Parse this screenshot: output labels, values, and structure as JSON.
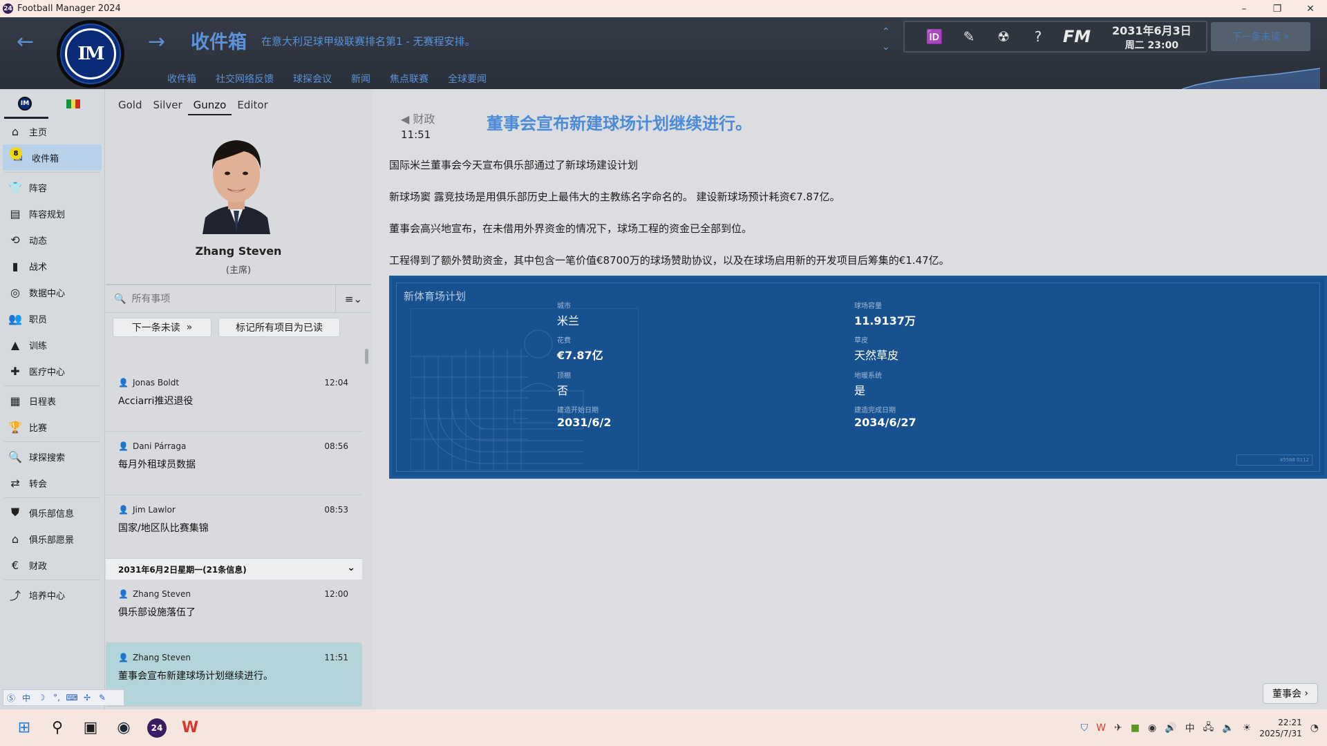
{
  "window": {
    "title": "Football Manager 2024",
    "icon_text": "24"
  },
  "header": {
    "title": "收件箱",
    "subtitle": "在意大利足球甲级联赛排名第1 - 无赛程安排。",
    "tabs": [
      "收件箱",
      "社交网络反馈",
      "球探会议",
      "新闻",
      "焦点联赛",
      "全球要闻"
    ],
    "date": "2031年6月3日",
    "day_time": "周二 23:00",
    "next_unread": "下一条未读",
    "fm_logo": "FM"
  },
  "sidebar": {
    "items": [
      {
        "icon": "home-icon",
        "glyph": "⌂",
        "label": "主页"
      },
      {
        "icon": "inbox-icon",
        "glyph": "✉",
        "label": "收件箱",
        "badge": "8"
      },
      {
        "icon": "squad-icon",
        "glyph": "👕",
        "label": "阵容"
      },
      {
        "icon": "squad-planner-icon",
        "glyph": "▤",
        "label": "阵容规划"
      },
      {
        "icon": "dynamics-icon",
        "glyph": "⟲",
        "label": "动态"
      },
      {
        "icon": "tactics-icon",
        "glyph": "▮",
        "label": "战术"
      },
      {
        "icon": "data-hub-icon",
        "glyph": "◎",
        "label": "数据中心"
      },
      {
        "icon": "staff-icon",
        "glyph": "👥",
        "label": "职员"
      },
      {
        "icon": "training-icon",
        "glyph": "▲",
        "label": "训练"
      },
      {
        "icon": "medical-icon",
        "glyph": "✚",
        "label": "医疗中心"
      },
      {
        "icon": "schedule-icon",
        "glyph": "▦",
        "label": "日程表"
      },
      {
        "icon": "competitions-icon",
        "glyph": "🏆",
        "label": "比赛"
      },
      {
        "icon": "scouting-icon",
        "glyph": "🔍",
        "label": "球探搜索"
      },
      {
        "icon": "transfers-icon",
        "glyph": "⇄",
        "label": "转会"
      },
      {
        "icon": "club-info-icon",
        "glyph": "⛊",
        "label": "俱乐部信息"
      },
      {
        "icon": "club-vision-icon",
        "glyph": "⌂",
        "label": "俱乐部愿景"
      },
      {
        "icon": "finances-icon",
        "glyph": "€",
        "label": "财政"
      },
      {
        "icon": "development-icon",
        "glyph": "⤴",
        "label": "培养中心"
      }
    ]
  },
  "middle": {
    "staff_tabs": [
      "Gold",
      "Silver",
      "Gunzo",
      "Editor"
    ],
    "person_name": "Zhang Steven",
    "person_role": "(主席)",
    "search_placeholder": "所有事项",
    "next_unread_btn": "下一条未读",
    "mark_read_btn": "标记所有项目为已读",
    "messages_top": [
      {
        "sender": "Jonas Boldt",
        "time": "12:04",
        "subject": "Acciarri推迟退役"
      },
      {
        "sender": "Dani Párraga",
        "time": "08:56",
        "subject": "每月外租球员数据"
      },
      {
        "sender": "Jim Lawlor",
        "time": "08:53",
        "subject": "国家/地区队比赛集锦"
      }
    ],
    "day_header": "2031年6月2日星期一(21条信息)",
    "messages_bottom": [
      {
        "sender": "Zhang Steven",
        "time": "12:00",
        "subject": "俱乐部设施落伍了"
      },
      {
        "sender": "Zhang Steven",
        "time": "11:51",
        "subject": "董事会宣布新建球场计划继续进行。"
      }
    ]
  },
  "news": {
    "category": "财政",
    "time": "11:51",
    "headline": "董事会宣布新建球场计划继续进行。",
    "paragraphs": [
      "国际米兰董事会今天宣布俱乐部通过了新球场建设计划",
      "新球场窦 露竞技场是用俱乐部历史上最伟大的主教练名字命名的。 建设新球场预计耗资€7.87亿。",
      "董事会高兴地宣布，在未借用外界资金的情况下，球场工程的资金已全部到位。",
      "工程得到了额外赞助资金，其中包含一笔价值€8700万的球场赞助协议，以及在球场启用新的开发项目后筹集的€1.47亿。"
    ],
    "card": {
      "title": "新体育场计划",
      "city_label": "城市",
      "city": "米兰",
      "capacity_label": "球场容量",
      "capacity": "11.9137万",
      "cost_label": "花费",
      "cost": "€7.87亿",
      "pitch_label": "草皮",
      "pitch": "天然草皮",
      "roof_label": "顶棚",
      "roof": "否",
      "heating_label": "地暖系统",
      "heating": "是",
      "start_label": "建造开始日期",
      "start": "2031/6/2",
      "end_label": "建造完成日期",
      "end": "2034/6/27",
      "small_code": "45588 0112"
    },
    "board_btn": "董事会"
  },
  "taskbar": {
    "time": "22:21",
    "date": "2025/7/31"
  },
  "colors": {
    "accent": "#4d8bd6",
    "card_bg": "#185190",
    "selected_msg": "#b3d4d8",
    "header_bg": "#2f353f"
  }
}
